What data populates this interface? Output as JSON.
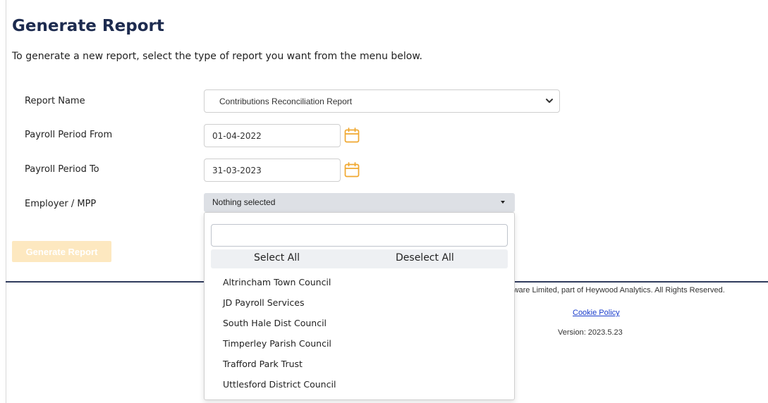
{
  "page": {
    "title": "Generate Report",
    "intro": "To generate a new report, select the type of report you want from the menu below."
  },
  "form": {
    "report_name_label": "Report Name",
    "report_name_value": "Contributions Reconciliation Report",
    "period_from_label": "Payroll Period From",
    "period_from_value": "01-04-2022",
    "period_to_label": "Payroll Period To",
    "period_to_value": "31-03-2023",
    "employer_label": "Employer / MPP",
    "employer_value": "Nothing selected",
    "generate_button": "Generate Report"
  },
  "employer_dropdown": {
    "search_value": "",
    "select_all": "Select All",
    "deselect_all": "Deselect All",
    "options": [
      "Altrincham Town Council",
      "JD Payroll Services",
      "South Hale Dist Council",
      "Timperley Parish Council",
      "Trafford Park Trust",
      "Uttlesford District Council"
    ]
  },
  "footer": {
    "copyright_visible": "Software Limited, part of Heywood Analytics. All Rights Reserved.",
    "cookie_link": "Cookie Policy",
    "version": "Version: 2023.5.23"
  },
  "colors": {
    "title": "#1d2b4f",
    "calendar_icon": "#f0a830",
    "generate_button_disabled": "#fde8c0",
    "divider": "#2f3a5c",
    "link": "#1a3dcc"
  }
}
